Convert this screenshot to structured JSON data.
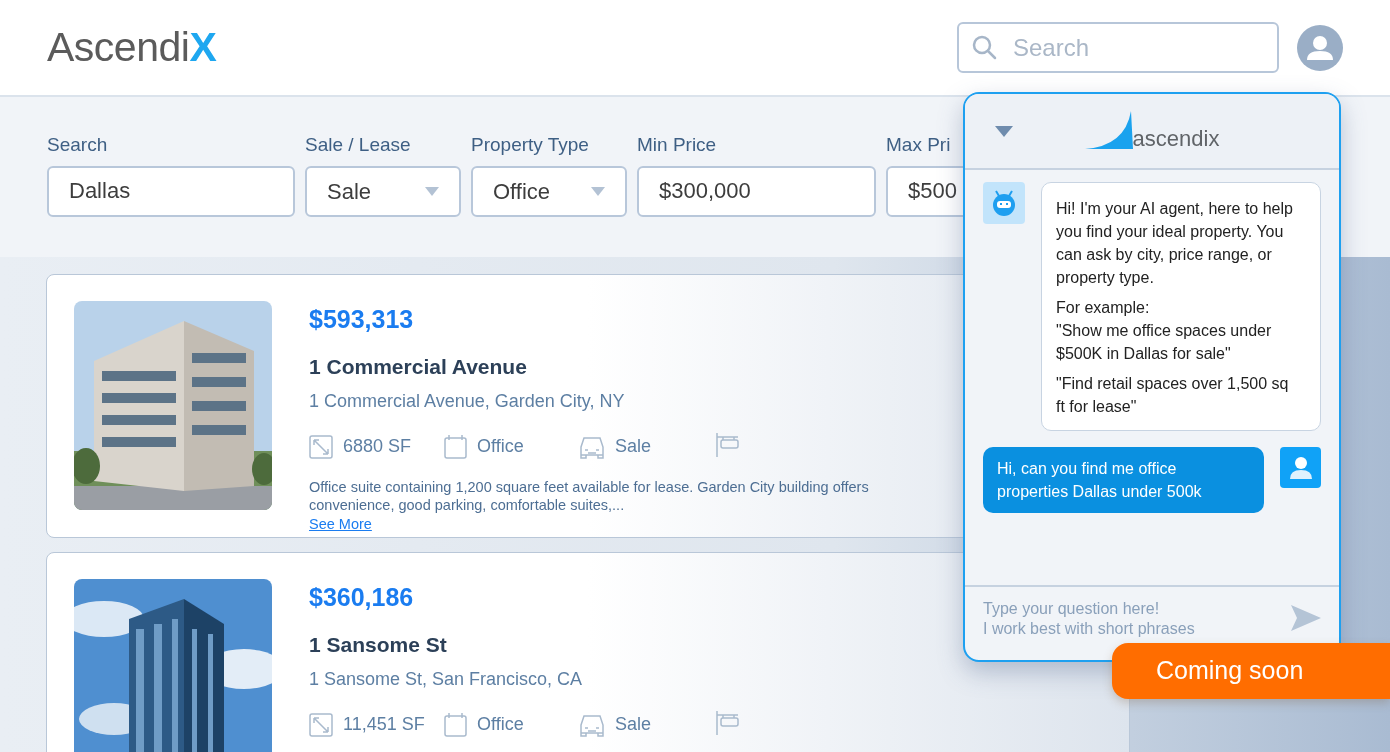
{
  "header": {
    "logo": {
      "text": "Ascendi",
      "accent": "X"
    },
    "search": {
      "placeholder": "Search"
    }
  },
  "filters": [
    {
      "label": "Search",
      "value": "Dallas",
      "kind": "text"
    },
    {
      "label": "Sale / Lease",
      "value": "Sale",
      "kind": "select"
    },
    {
      "label": "Property Type",
      "value": "Office",
      "kind": "select"
    },
    {
      "label": "Min Price",
      "value": "$300,000",
      "kind": "text"
    },
    {
      "label": "Max Pri",
      "value": "$500",
      "kind": "text"
    }
  ],
  "listings": [
    {
      "price": "$593,313",
      "title": "1 Commercial Avenue",
      "address": "1 Commercial Avenue, Garden City, NY",
      "area": "6880 SF",
      "type": "Office",
      "deal": "Sale",
      "description": "Office suite containing 1,200 square feet available for lease. Garden City building offers convenience, good parking, comfortable suites,...",
      "link": "See More"
    },
    {
      "price": "$360,186",
      "title": "1 Sansome St",
      "address": "1 Sansome St, San Francisco, CA",
      "area": "11,451 SF",
      "type": "Office",
      "deal": "Sale"
    }
  ],
  "chat": {
    "logo": "ascendix",
    "messages": [
      {
        "kind": "bot",
        "paragraphs": [
          "Hi! I'm your AI agent, here to help you find your ideal property. You can ask by city, price range, or property type.",
          "For example:",
          "\"Show me office spaces under $500K in Dallas for sale\"",
          "\"Find retail spaces over 1,500 sq ft for lease\""
        ]
      },
      {
        "kind": "user",
        "paragraphs": [
          "Hi, can you find me office properties Dallas under 500k"
        ]
      }
    ],
    "input": {
      "placeholder": "Type your question here!\nI work best with short phrases"
    }
  },
  "badge": "Coming soon"
}
